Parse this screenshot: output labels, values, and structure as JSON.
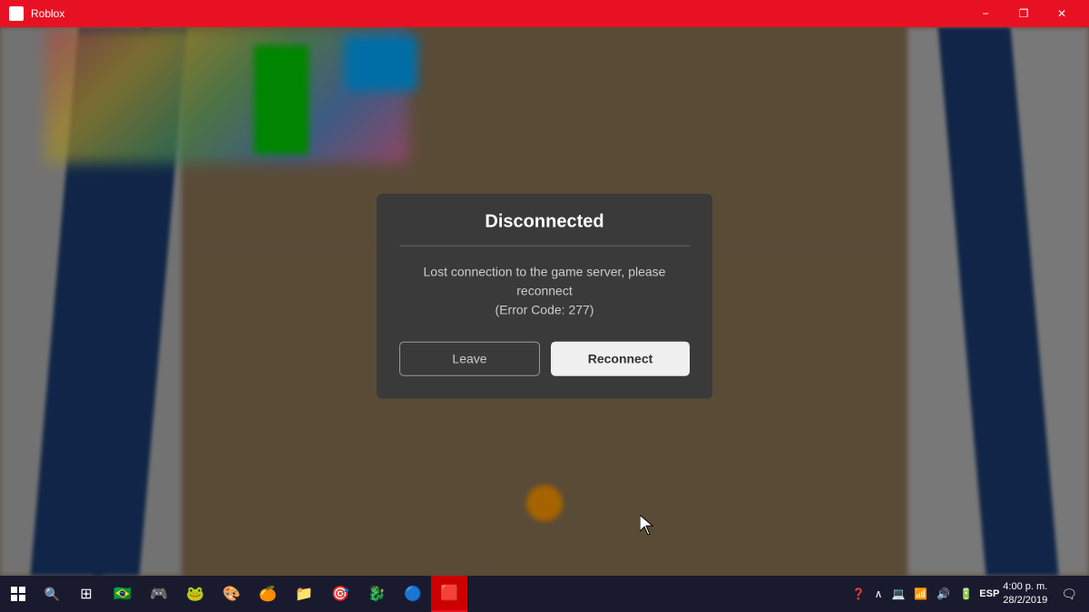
{
  "titlebar": {
    "title": "Roblox",
    "minimize_label": "−",
    "maximize_label": "❐",
    "close_label": "✕"
  },
  "dialog": {
    "title": "Disconnected",
    "message": "Lost connection to the game server, please reconnect\n(Error Code: 277)",
    "leave_label": "Leave",
    "reconnect_label": "Reconnect"
  },
  "taskbar": {
    "time": "4:00 p. m.",
    "date": "28/2/2019",
    "language": "ESP",
    "notification_icon": "🔔"
  }
}
